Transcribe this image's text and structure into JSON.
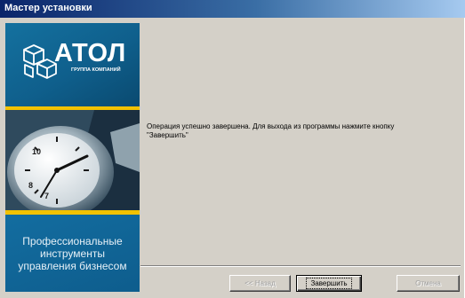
{
  "window": {
    "title": "Мастер установки"
  },
  "sidebar": {
    "logo_text": "АТОЛ",
    "logo_subtext": "ГРУППА КОМПАНИЙ",
    "slogan_lines": [
      "Профессиональные",
      "инструменты",
      "управления бизнесом"
    ],
    "brand_colors": {
      "panel_blue": "#0d5d8e",
      "accent_yellow": "#f2c200"
    }
  },
  "main": {
    "message_line1": "Операция успешно завершена. Для выхода из программы нажмите кнопку",
    "message_line2": "\"Завершить\""
  },
  "buttons": {
    "back_label": "<< Назад",
    "finish_label": "Завершить",
    "cancel_label": "Отмена"
  },
  "states": {
    "back_enabled": false,
    "finish_enabled": true,
    "finish_default": true,
    "cancel_enabled": false
  }
}
